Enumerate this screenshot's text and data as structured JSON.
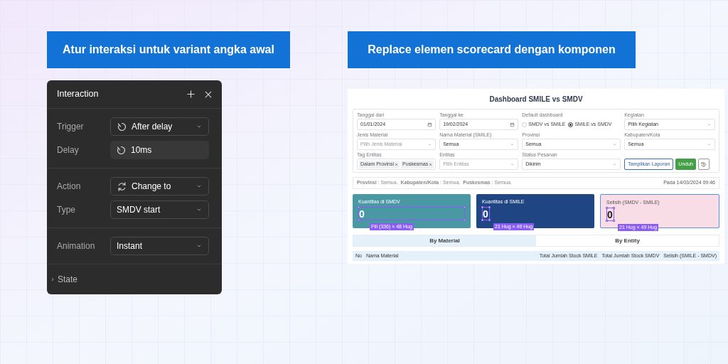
{
  "left": {
    "heading": "Atur interaksi untuk variant angka awal",
    "panel": {
      "title": "Interaction",
      "sections": [
        {
          "rows": [
            {
              "label": "Trigger",
              "kind": "timer-select",
              "value": "After delay"
            },
            {
              "label": "Delay",
              "kind": "timer-field",
              "value": "10ms"
            }
          ]
        },
        {
          "rows": [
            {
              "label": "Action",
              "kind": "swap-select",
              "value": "Change to"
            },
            {
              "label": "Type",
              "kind": "select",
              "value": "SMDV start"
            }
          ]
        },
        {
          "rows": [
            {
              "label": "Animation",
              "kind": "select",
              "value": "Instant"
            }
          ]
        }
      ],
      "footer": {
        "label": "State",
        "expanded": false
      }
    }
  },
  "right": {
    "heading": "Replace elemen scorecard dengan komponen",
    "dashboard": {
      "title": "Dashboard SMILE vs SMDV",
      "filters": [
        {
          "kind": "date",
          "label": "Tanggal dari",
          "value": "01/01/2024"
        },
        {
          "kind": "date",
          "label": "Tanggal ke",
          "value": "19/02/2024"
        },
        {
          "kind": "radio",
          "label": "Default dashboard",
          "options": [
            {
              "label": "SMDV vs SMILE",
              "selected": false
            },
            {
              "label": "SMILE vs SMDV",
              "selected": true
            }
          ]
        },
        {
          "kind": "select",
          "label": "Kegiatan",
          "value": "Pilih Kegiatan"
        },
        {
          "kind": "select",
          "label": "Jenis Material",
          "placeholder": "Pilih Jenis Material"
        },
        {
          "kind": "select",
          "label": "Nama Material (SMILE)",
          "value": "Semua"
        },
        {
          "kind": "select",
          "label": "Provinsi",
          "value": "Semua"
        },
        {
          "kind": "select",
          "label": "Kabupaten/Kota",
          "value": "Semua"
        },
        {
          "kind": "tags",
          "label": "Tag Entitas",
          "tags": [
            "Dalam Provinsi",
            "Puskesmas"
          ]
        },
        {
          "kind": "select",
          "label": "Entitas",
          "placeholder": "Pilih Entitas"
        },
        {
          "kind": "select",
          "label": "Status Pesanan",
          "value": "Dikirim"
        }
      ],
      "buttons": [
        {
          "kind": "outline",
          "label": "Tampilkan Laporan"
        },
        {
          "kind": "solid",
          "label": "Unduh"
        },
        {
          "kind": "reset"
        }
      ],
      "summary": [
        "**Provinsi** : Semua.",
        "**Kabupaten/Kota** : Semua.",
        "**Puskesmas** : Semua."
      ],
      "timestamp": "Pada 14/03/2024 09:46",
      "cards": [
        {
          "kind": "wide",
          "label": "Kuantitas di SMDV",
          "value": "0",
          "color": "#4a98a3",
          "dimensions": "Fill (336) × 48 Hug",
          "selected": false
        },
        {
          "kind": "narrow",
          "label": "Kuantitas di SMILE",
          "value": "0",
          "color": "#1f4683",
          "dimensions": "21 Hug × 49 Hug",
          "selected": false
        },
        {
          "kind": "narrow",
          "label": "Selisih (SMDV - SMILE)",
          "value": "0",
          "color": "#f9dde6",
          "dimensions": "21 Hug × 49 Hug",
          "selected": true
        }
      ],
      "tabs": [
        {
          "label": "By Material",
          "selected": true
        },
        {
          "label": "By Entity",
          "selected": false
        }
      ],
      "table": {
        "columns": [
          "No",
          "Nama Material",
          "Total Jumlah Stock SMILE",
          "Total Jumlah Stock SMDV",
          "Selisih (SMILE - SMDV)"
        ]
      }
    }
  }
}
